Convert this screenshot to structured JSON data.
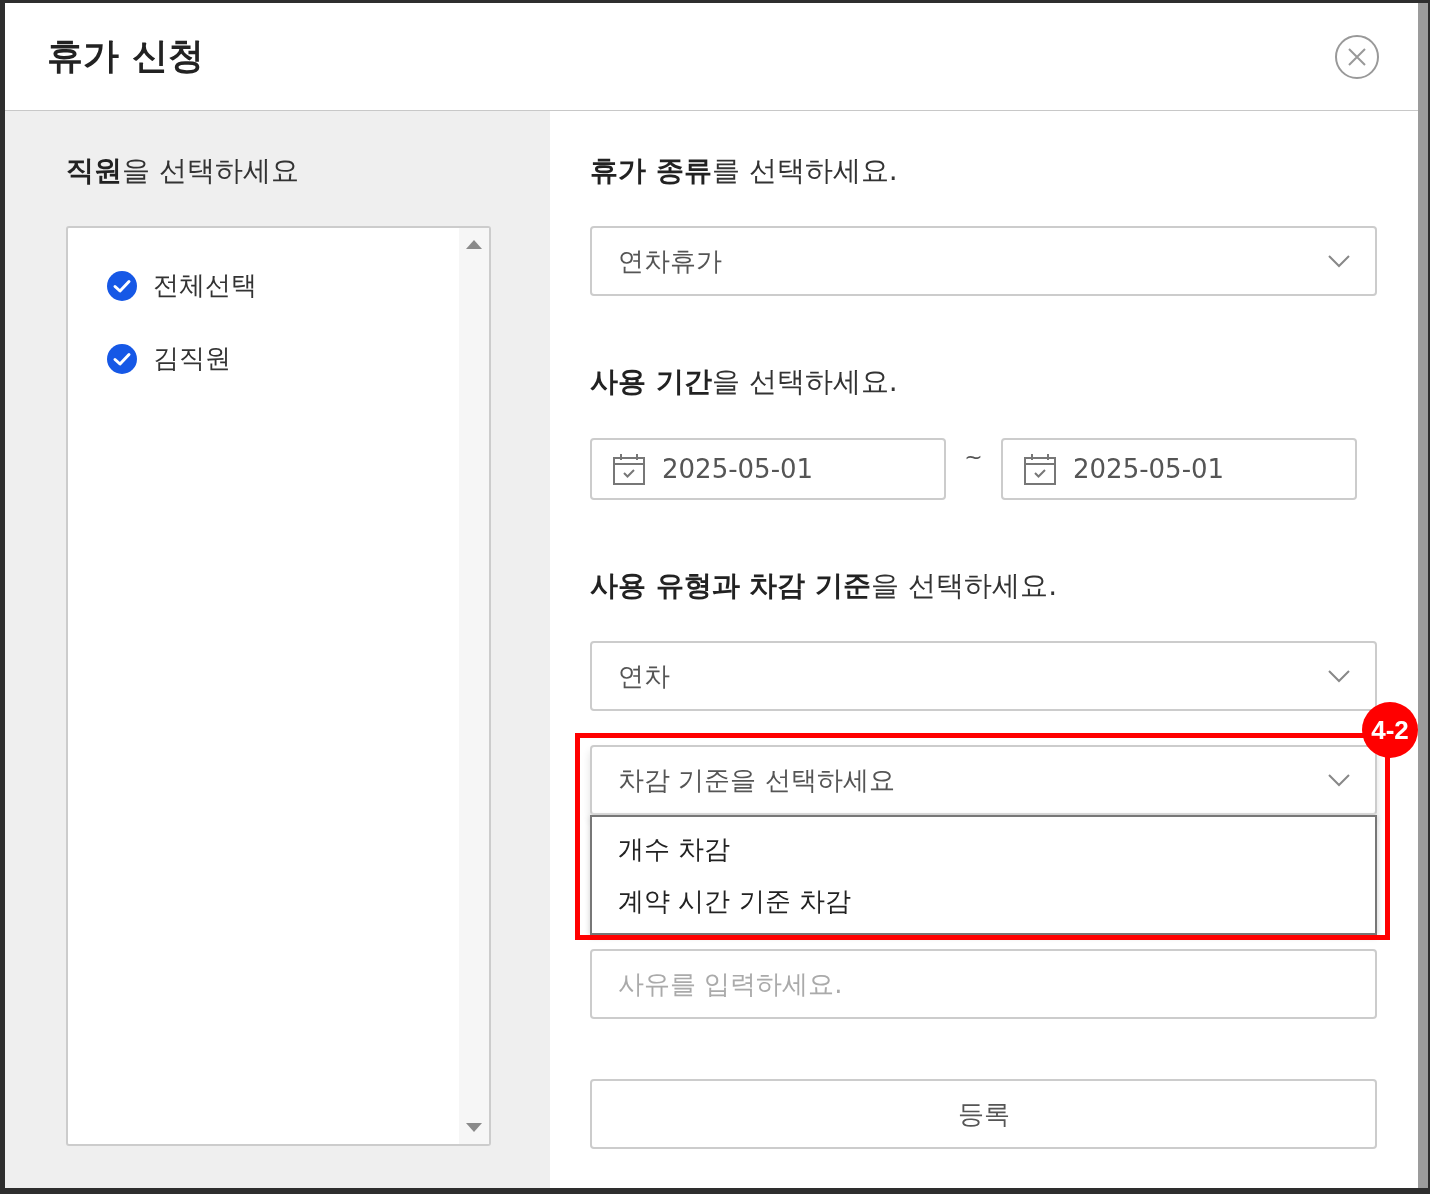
{
  "dialog": {
    "title": "휴가 신청"
  },
  "employees": {
    "heading": "**직원**을 선택하세요",
    "items": [
      {
        "label": "전체선택",
        "checked": true
      },
      {
        "label": "김직원",
        "checked": true
      }
    ]
  },
  "leave_type": {
    "heading": "**휴가 종류**를 선택하세요.",
    "value": "연차휴가"
  },
  "period": {
    "heading": "**사용 기간**을 선택하세요.",
    "start": "2025-05-01",
    "separator": "~",
    "end": "2025-05-01"
  },
  "usage": {
    "heading": "**사용 유형과 차감 기준**을 선택하세요.",
    "usage_type": "연차",
    "deduction": {
      "placeholder": "차감 기준을 선택하세요",
      "expanded": true,
      "options": [
        {
          "label": "개수 차감"
        },
        {
          "label": "계약 시간 기준 차감"
        }
      ]
    }
  },
  "reason": {
    "placeholder": "사유를 입력하세요."
  },
  "submit": "등록",
  "annotation": {
    "label": "4-2"
  }
}
